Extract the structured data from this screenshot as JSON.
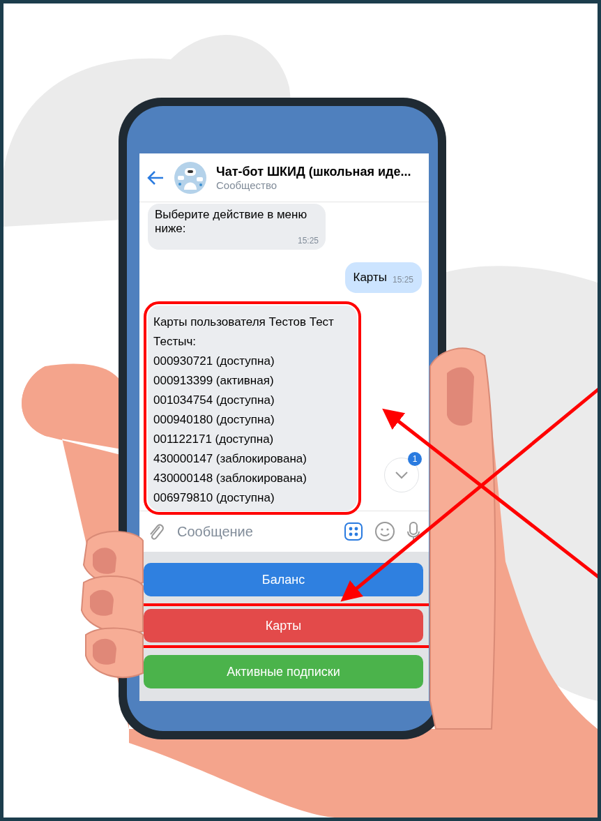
{
  "header": {
    "title": "Чат-бот ШКИД (школьная иде...",
    "subtitle": "Сообщество"
  },
  "messages": [
    {
      "kind": "incoming",
      "text": "Выберите действие в меню ниже:",
      "time": "15:25",
      "highlighted": false
    },
    {
      "kind": "outgoing",
      "text": "Карты",
      "time": "15:25",
      "highlighted": false
    },
    {
      "kind": "card_list",
      "heading": "Карты пользователя Тестов Тест Тестыч:",
      "lines": [
        "000930721 (доступна)",
        "000913399 (активная)",
        "001034754 (доступна)",
        "000940180 (доступна)",
        "001122171 (доступна)",
        "430000147 (заблокирована)",
        "430000148 (заблокирована)",
        "006979810 (доступна)"
      ],
      "highlighted": true
    }
  ],
  "scroll_button": {
    "badge": "1"
  },
  "composer": {
    "placeholder": "Сообщение"
  },
  "keyboard": [
    {
      "label": "Баланс",
      "color": "#2f80e0",
      "highlighted": false
    },
    {
      "label": "Карты",
      "color": "#e34a4a",
      "highlighted": true
    },
    {
      "label": "Активные подписки",
      "color": "#4bb34b",
      "highlighted": false
    }
  ]
}
